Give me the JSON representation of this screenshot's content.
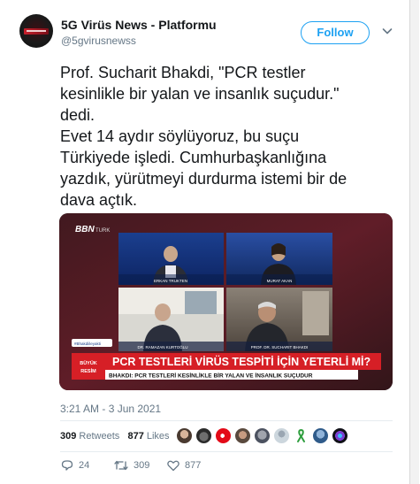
{
  "header": {
    "display_name": "5G Virüs News - Platformu",
    "handle": "@5gvirusnewss",
    "follow_label": "Follow"
  },
  "tweet": {
    "lines": [
      "Prof. Sucharit Bhakdi, \"PCR testler",
      "kesinlikle bir yalan ve insanlık suçudur.\"",
      "dedi.",
      "Evet 14 aydır söylüyoruz, bu suçu",
      "Türkiyede işledi. Cumhurbaşkanlığına",
      "yazdık, yürütmeyi durdurma istemi bir de",
      "dava açtık."
    ],
    "timestamp": "3:21 AM - 3 Jun 2021"
  },
  "media": {
    "channel_logo": "BBN",
    "channel_suffix": "TURK",
    "hashtag": "#Bhakdiileyakti",
    "panels": [
      {
        "caption": "ERKAN TRUKTEN"
      },
      {
        "caption": "MURAT AKAN"
      },
      {
        "caption": "DR. RAMAZAN KURTOĞLU"
      },
      {
        "caption": "PROF. DR. SUCHARIT BHAKDI"
      }
    ],
    "badge_line1": "BÜYÜK",
    "badge_line2": "RESİM",
    "headline": "PCR TESTLERİ VİRÜS TESPİTİ İÇİN YETERLİ Mİ?",
    "subline": "BHAKDI: PCR TESTLERİ KESİNLİKLE BİR YALAN VE İNSANLIK SUÇUDUR"
  },
  "stats": {
    "retweets_count": "309",
    "retweets_label": "Retweets",
    "likes_count": "877",
    "likes_label": "Likes"
  },
  "actions": {
    "replies": "24",
    "retweets": "309",
    "likes": "877"
  },
  "colors": {
    "accent": "#1da1f2",
    "muted": "#657786",
    "headline_red": "#d61f26"
  }
}
